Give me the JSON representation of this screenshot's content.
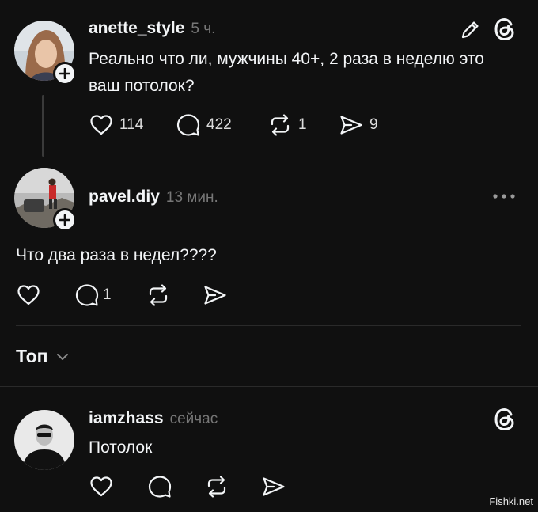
{
  "post": {
    "username": "anette_style",
    "time": "5 ч.",
    "text": "Реально что ли, мужчины 40+, 2 раза в неделю это ваш потолок?",
    "likes": "114",
    "comments": "422",
    "reposts": "1",
    "shares": "9"
  },
  "reply": {
    "username": "pavel.diy",
    "time": "13 мин.",
    "text": "Что два раза в недел????",
    "comments": "1"
  },
  "sort": {
    "label": "Топ"
  },
  "comment": {
    "username": "iamzhass",
    "time": "сейчас",
    "text": "Потолок"
  },
  "watermark": "Fishki.net",
  "icons": {
    "edit": "pencil-icon",
    "threads": "threads-logo-icon",
    "like": "heart-icon",
    "comment": "speech-bubble-icon",
    "repost": "repost-icon",
    "share": "send-icon",
    "more": "more-dots-icon",
    "chevron": "chevron-down-icon",
    "follow": "plus-icon"
  },
  "colors": {
    "background": "#101010",
    "text": "#f3f5f7",
    "muted": "#777777"
  }
}
